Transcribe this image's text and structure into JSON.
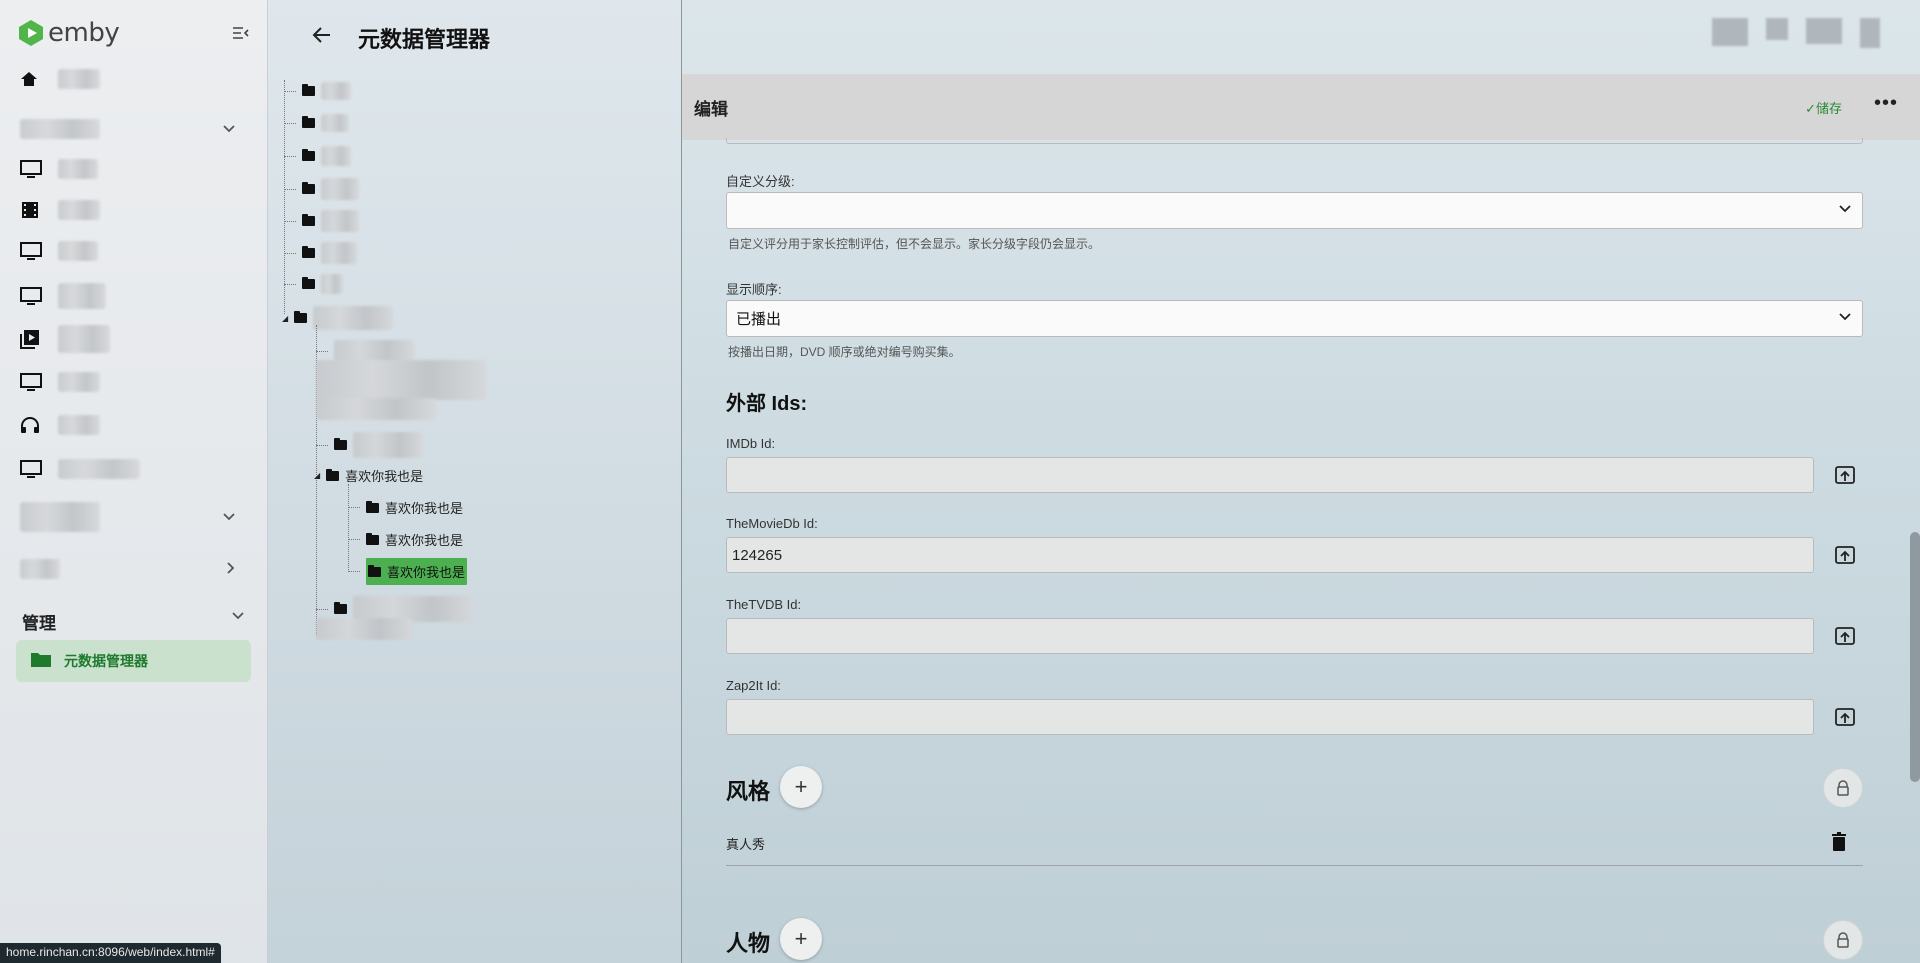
{
  "app": {
    "logo_text": "emby",
    "brand_color": "#52b54b"
  },
  "sidebar": {
    "section_label": "管理",
    "active_item": "元数据管理器"
  },
  "tree_panel": {
    "title": "元数据管理器",
    "nodes": {
      "parent": "喜欢你我也是",
      "child1": "喜欢你我也是",
      "child2": "喜欢你我也是",
      "child3_selected": "喜欢你我也是"
    }
  },
  "editor": {
    "header_title": "编辑",
    "save_label": "✓储存",
    "custom_rating_label": "自定义分级:",
    "custom_rating_value": "",
    "custom_rating_hint": "自定义评分用于家长控制评估，但不会显示。家长分级字段仍会显示。",
    "display_order_label": "显示顺序:",
    "display_order_value": "已播出",
    "display_order_hint": "按播出日期，DVD 顺序或绝对编号购买集。",
    "external_ids_heading": "外部 Ids:",
    "imdb_label": "IMDb Id:",
    "imdb_value": "",
    "tmdb_label": "TheMovieDb Id:",
    "tmdb_value": "124265",
    "tvdb_label": "TheTVDB Id:",
    "tvdb_value": "",
    "zap2it_label": "Zap2It Id:",
    "zap2it_value": "",
    "genres_heading": "风格",
    "genres": [
      "真人秀"
    ],
    "people_heading": "人物"
  },
  "status_url": "home.rinchan.cn:8096/web/index.html#"
}
